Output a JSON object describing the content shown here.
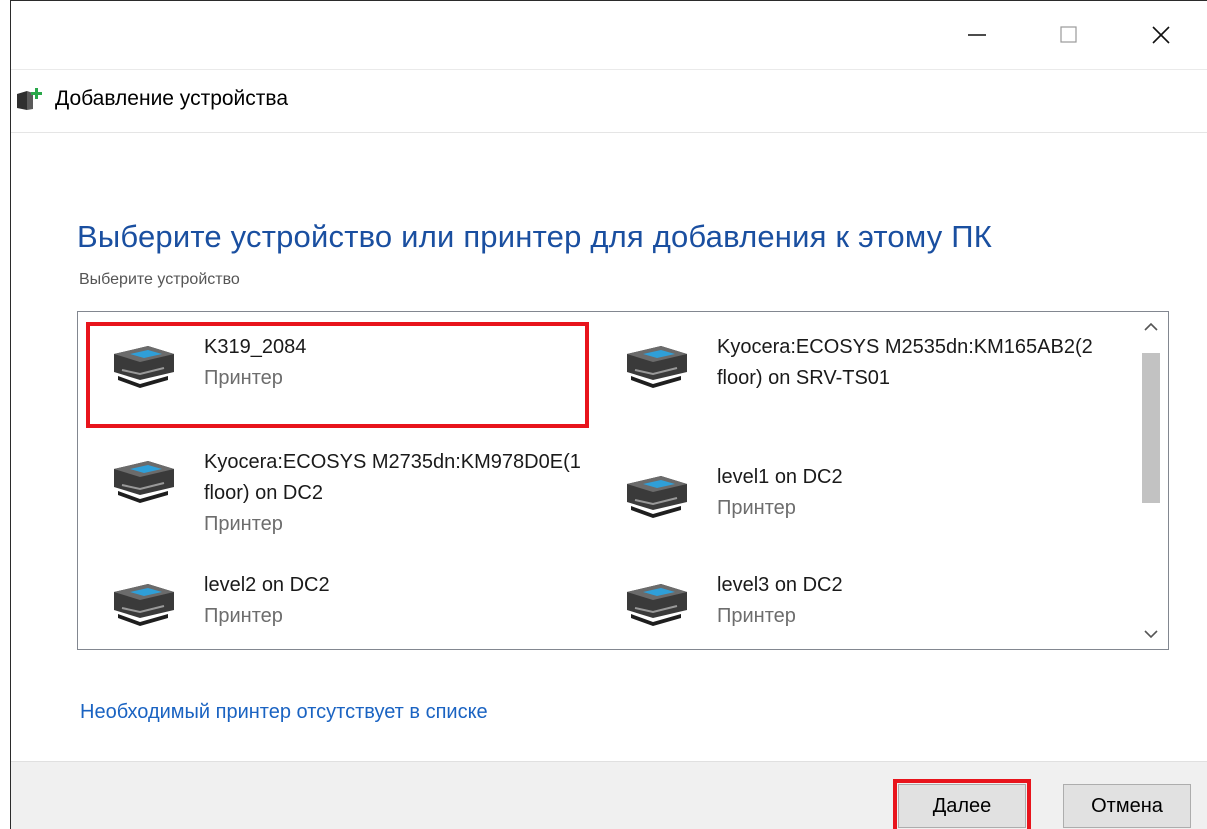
{
  "window": {
    "title": "Добавление устройства",
    "controls": [
      "minimize-icon",
      "maximize-icon",
      "close-icon"
    ]
  },
  "page": {
    "heading": "Выберите устройство или принтер для добавления к этому ПК",
    "subheading": "Выберите устройство"
  },
  "devices": [
    {
      "name": "K319_2084",
      "type": "Принтер",
      "icon": "printer-icon",
      "selected": true
    },
    {
      "name": "Kyocera:ECOSYS M2535dn:KM165AB2(2 floor) on SRV-TS01",
      "type": "",
      "icon": "printer-icon",
      "selected": false
    },
    {
      "name": "Kyocera:ECOSYS M2735dn:KM978D0E(1 floor) on DC2",
      "type": "Принтер",
      "icon": "printer-icon",
      "selected": false
    },
    {
      "name": "level1 on DC2",
      "type": "Принтер",
      "icon": "printer-icon",
      "selected": false
    },
    {
      "name": "level2 on DC2",
      "type": "Принтер",
      "icon": "printer-icon",
      "selected": false
    },
    {
      "name": "level3 on DC2",
      "type": "Принтер",
      "icon": "printer-icon",
      "selected": false
    }
  ],
  "link": {
    "missing_printer": "Необходимый принтер отсутствует в списке"
  },
  "buttons": {
    "next": "Далее",
    "cancel": "Отмена"
  },
  "colors": {
    "heading": "#1a4fa0",
    "link": "#1a63c2",
    "highlight": "#e8141c"
  }
}
